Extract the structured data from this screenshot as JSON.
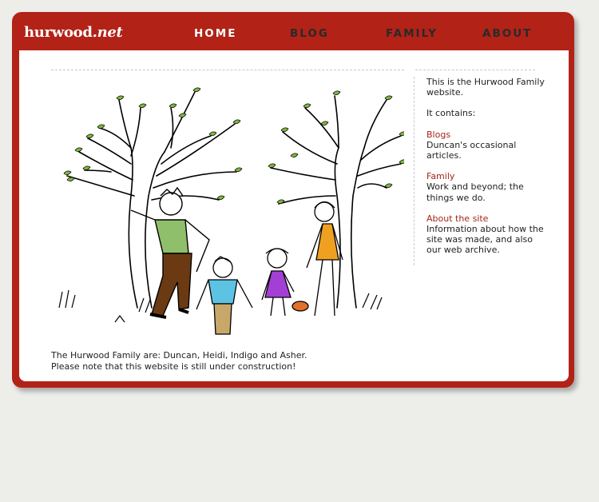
{
  "site": {
    "logo_name": "hurwood",
    "logo_tld": ".net"
  },
  "nav": {
    "items": [
      {
        "label": "HOME",
        "active": true
      },
      {
        "label": "BLOG",
        "active": false
      },
      {
        "label": "FAMILY",
        "active": false
      },
      {
        "label": "ABOUT",
        "active": false
      }
    ]
  },
  "main": {
    "caption_line1": "The Hurwood Family are: Duncan, Heidi, Indigo and Asher.",
    "caption_line2": "Please note that this website is still under construction!"
  },
  "sidebar": {
    "intro": "This is the Hurwood Family website.",
    "contains": "It contains:",
    "sections": [
      {
        "link": "Blogs",
        "desc": "Duncan's occasional articles."
      },
      {
        "link": "Family",
        "desc": "Work and beyond; the things we do."
      },
      {
        "link": "About the site",
        "desc": "Information about how the site was made, and also our web archive."
      }
    ]
  },
  "colors": {
    "frame": "#b22217",
    "background": "#ededea",
    "link": "#a3271c",
    "nav_active": "#ffffff",
    "nav_inactive": "#2a2a2a",
    "leaf": "#7cba3a",
    "dad_shirt": "#8fbf6a",
    "dad_trousers": "#6b3a12",
    "boy_shirt": "#5cc3e4",
    "girl_dress": "#a43fd6",
    "mum_dress": "#f0a020"
  },
  "icons": [
    "family-drawing"
  ]
}
